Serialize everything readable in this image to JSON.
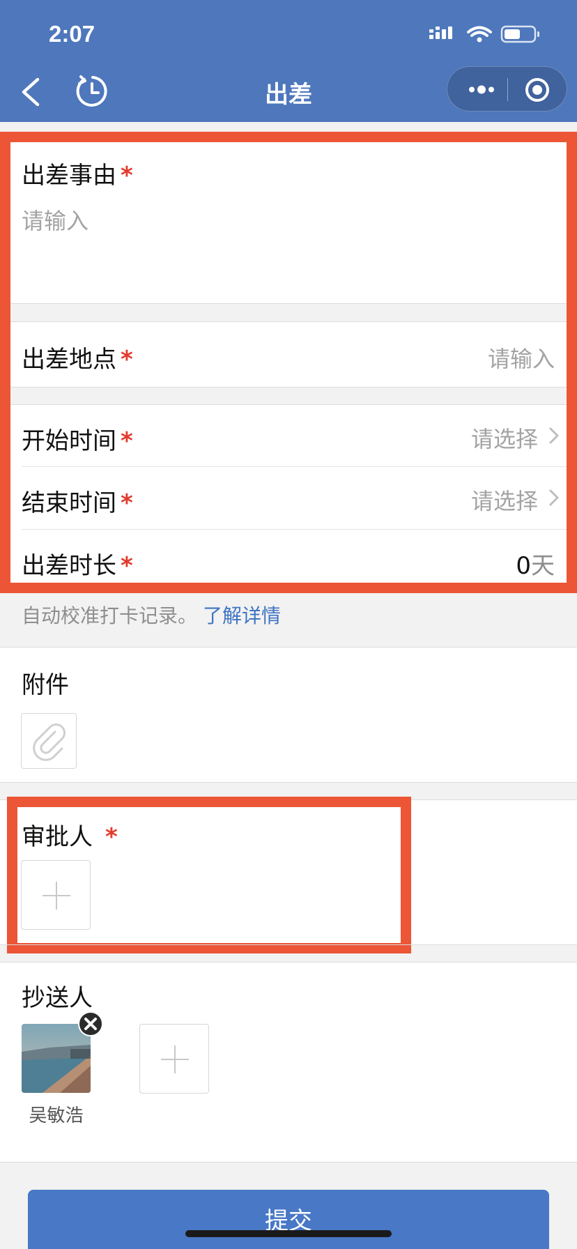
{
  "status_bar": {
    "time": "2:07"
  },
  "nav": {
    "title": "出差"
  },
  "form": {
    "reason": {
      "label": "出差事由",
      "required_mark": "*",
      "placeholder": "请输入"
    },
    "location": {
      "label": "出差地点",
      "required_mark": "*",
      "placeholder": "请输入"
    },
    "start_time": {
      "label": "开始时间",
      "required_mark": "*",
      "placeholder": "请选择"
    },
    "end_time": {
      "label": "结束时间",
      "required_mark": "*",
      "placeholder": "请选择"
    },
    "duration": {
      "label": "出差时长",
      "required_mark": "*",
      "value": "0",
      "unit": "天"
    }
  },
  "hint": {
    "text": "自动校准打卡记录。",
    "link": "了解详情"
  },
  "attachment": {
    "label": "附件"
  },
  "approver": {
    "label": "审批人",
    "required_mark": "*"
  },
  "cc": {
    "label": "抄送人",
    "people": [
      {
        "name": "吴敏浩"
      }
    ]
  },
  "submit": {
    "label": "提交"
  },
  "colors": {
    "header": "#4e77bc",
    "required": "#e23b2c",
    "link": "#3f74c4",
    "highlight": "#ec5536",
    "button": "#4878c6"
  }
}
